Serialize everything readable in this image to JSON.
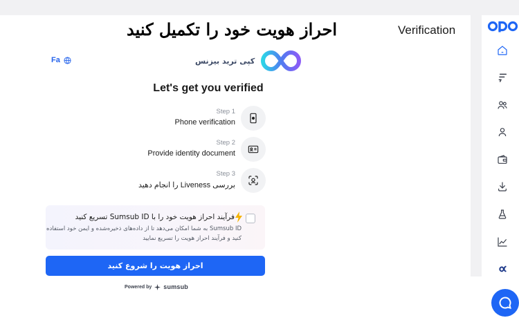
{
  "banner": {
    "title": "احراز هویت خود را تکمیل کنید"
  },
  "page_title": "Verification",
  "language": {
    "label": "Fa",
    "icon": "globe-icon"
  },
  "brand": {
    "name": "کپی ترید بیزنس",
    "logo": "infinity-logo"
  },
  "heading": "Let's get you verified",
  "steps": [
    {
      "label": "Step 1",
      "text": "Phone verification",
      "icon": "phone-icon"
    },
    {
      "label": "Step 2",
      "text": "Provide identity document",
      "icon": "id-card-icon"
    },
    {
      "label": "Step 3",
      "text": "بررسی Liveness را انجام دهید",
      "icon": "face-scan-icon"
    }
  ],
  "sumsub_id": {
    "title": "فرآیند احراز هویت خود را با Sumsub ID تسریع کنید",
    "description": "Sumsub ID به شما امکان می‌دهد تا از داده‌های ذخیره‌شده و ایمن خود استفاده کنید و فرآیند احراز هویت را تسریع نمایید",
    "checked": false,
    "icon": "lightning-icon"
  },
  "start_button": "احراز هویت را شروع کنید",
  "powered_by": {
    "prefix": "Powered by",
    "name": "sumsub"
  },
  "sidebar": {
    "logo": "opo-logo",
    "items": [
      {
        "name": "home",
        "icon": "home-icon"
      },
      {
        "name": "signals",
        "icon": "flash-lines-icon"
      },
      {
        "name": "users",
        "icon": "users-icon"
      },
      {
        "name": "profile",
        "icon": "user-icon"
      },
      {
        "name": "wallet",
        "icon": "wallet-icon"
      },
      {
        "name": "download",
        "icon": "download-icon"
      },
      {
        "name": "lab",
        "icon": "flask-icon"
      },
      {
        "name": "chart",
        "icon": "chart-line-icon"
      },
      {
        "name": "alpha",
        "icon": "alpha-icon"
      }
    ]
  },
  "colors": {
    "accent": "#1e66f5",
    "banner_bg": "#f1f1f3",
    "step_icon_bg": "#f1f2f4"
  }
}
